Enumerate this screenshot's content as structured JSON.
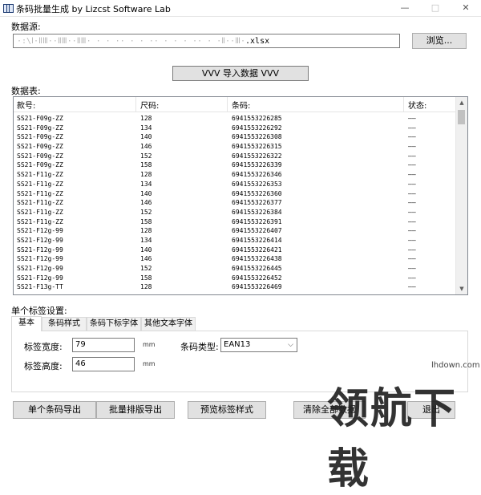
{
  "window": {
    "title": "条码批量生成   by Lizcst Software Lab",
    "minimize": "—",
    "maximize": "□",
    "close": "✕"
  },
  "datasource": {
    "label": "数据源:",
    "path_obscured": "·:\\Ⅰ·ⅡⅢ··ⅡⅢ··ⅡⅢ·   ·  ·  ··  ·  ·  ··  ·   · ·    ·· ·   ·Ⅱ··Ⅲ·",
    "path_suffix": ".xlsx",
    "browse_label": "浏览..."
  },
  "import_button": "VVV 导入数据 VVV",
  "table": {
    "label": "数据表:",
    "columns": [
      "款号:",
      "尺码:",
      "条码:",
      "状态:"
    ],
    "rows": [
      [
        "SS21-F09g-ZZ",
        "128",
        "6941553226285",
        "——"
      ],
      [
        "SS21-F09g-ZZ",
        "134",
        "6941553226292",
        "——"
      ],
      [
        "SS21-F09g-ZZ",
        "140",
        "6941553226308",
        "——"
      ],
      [
        "SS21-F09g-ZZ",
        "146",
        "6941553226315",
        "——"
      ],
      [
        "SS21-F09g-ZZ",
        "152",
        "6941553226322",
        "——"
      ],
      [
        "SS21-F09g-ZZ",
        "158",
        "6941553226339",
        "——"
      ],
      [
        "SS21-F11g-ZZ",
        "128",
        "6941553226346",
        "——"
      ],
      [
        "SS21-F11g-ZZ",
        "134",
        "6941553226353",
        "——"
      ],
      [
        "SS21-F11g-ZZ",
        "140",
        "6941553226360",
        "——"
      ],
      [
        "SS21-F11g-ZZ",
        "146",
        "6941553226377",
        "——"
      ],
      [
        "SS21-F11g-ZZ",
        "152",
        "6941553226384",
        "——"
      ],
      [
        "SS21-F11g-ZZ",
        "158",
        "6941553226391",
        "——"
      ],
      [
        "SS21-F12g-99",
        "128",
        "6941553226407",
        "——"
      ],
      [
        "SS21-F12g-99",
        "134",
        "6941553226414",
        "——"
      ],
      [
        "SS21-F12g-99",
        "140",
        "6941553226421",
        "——"
      ],
      [
        "SS21-F12g-99",
        "146",
        "6941553226438",
        "——"
      ],
      [
        "SS21-F12g-99",
        "152",
        "6941553226445",
        "——"
      ],
      [
        "SS21-F12g-99",
        "158",
        "6941553226452",
        "——"
      ],
      [
        "SS21-F13g-TT",
        "128",
        "6941553226469",
        "——"
      ]
    ]
  },
  "settings": {
    "label": "单个标签设置:",
    "tabs": [
      "基本",
      "条码样式",
      "条码下标字体",
      "其他文本字体"
    ],
    "width_label": "标签宽度:",
    "width_value": "79",
    "height_label": "标签高度:",
    "height_value": "46",
    "unit": "mm",
    "type_label": "条码类型:",
    "type_value": "EAN13"
  },
  "bottom_buttons": {
    "single_export": "单个条码导出",
    "batch_export": "批量排版导出",
    "preview": "预览标签样式",
    "clear": "清除全部数据",
    "exit": "退出"
  },
  "watermark": {
    "url": "lhdown.com",
    "text": "领航下载"
  }
}
